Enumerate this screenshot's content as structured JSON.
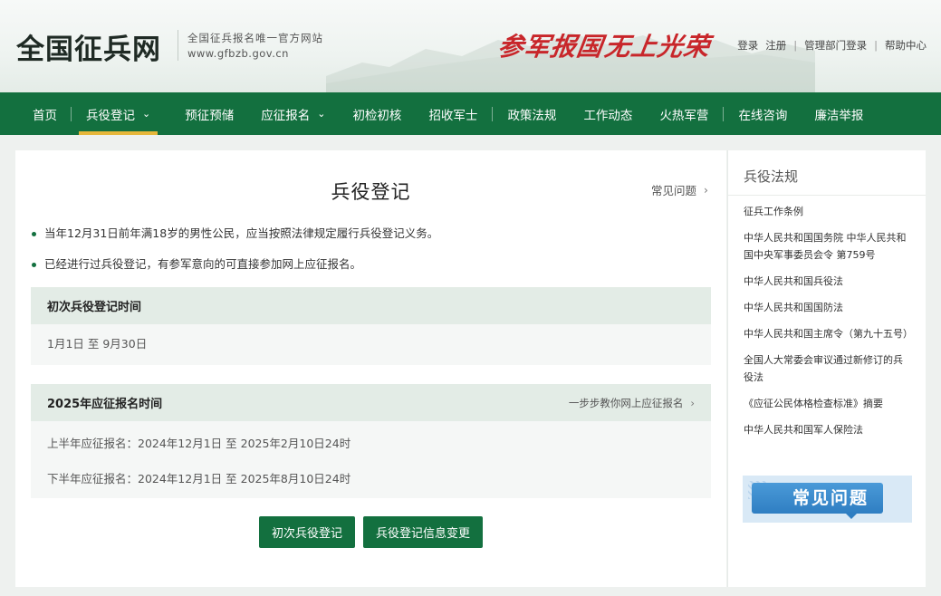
{
  "header": {
    "site_name": "全国征兵网",
    "tagline": "全国征兵报名唯一官方网站",
    "url": "www.gfbzb.gov.cn",
    "slogan_1": "参军报国",
    "slogan_2": "无上光荣",
    "links": {
      "login": "登录",
      "register": "注册",
      "admin_login": "管理部门登录",
      "help": "帮助中心"
    }
  },
  "nav": {
    "items": [
      {
        "label": "首页"
      },
      {
        "label": "兵役登记"
      },
      {
        "label": "预征预储"
      },
      {
        "label": "应征报名"
      },
      {
        "label": "初检初核"
      },
      {
        "label": "招收军士"
      },
      {
        "label": "政策法规"
      },
      {
        "label": "工作动态"
      },
      {
        "label": "火热军营"
      },
      {
        "label": "在线咨询"
      },
      {
        "label": "廉洁举报"
      }
    ],
    "active": "兵役登记"
  },
  "main": {
    "title": "兵役登记",
    "faq_link": "常见问题",
    "bullets": [
      "当年12月31日前年满18岁的男性公民，应当按照法律规定履行兵役登记义务。",
      "已经进行过兵役登记，有参军意向的可直接参加网上应征报名。"
    ],
    "first_registration": {
      "title": "初次兵役登记时间",
      "period": "1月1日 至 9月30日"
    },
    "enlistment": {
      "title": "2025年应征报名时间",
      "guide_link": "一步步教你网上应征报名",
      "first_half": "上半年应征报名：2024年12月1日 至 2025年2月10日24时",
      "second_half": "下半年应征报名：2024年12月1日 至 2025年8月10日24时"
    },
    "buttons": {
      "first_registration": "初次兵役登记",
      "info_change": "兵役登记信息变更"
    }
  },
  "sidebar": {
    "title": "兵役法规",
    "items": [
      "征兵工作条例",
      "中华人民共和国国务院 中华人民共和国中央军事委员会令 第759号",
      "中华人民共和国兵役法",
      "中华人民共和国国防法",
      "中华人民共和国主席令（第九十五号）",
      "全国人大常委会审议通过新修订的兵役法",
      "《应征公民体格检查标准》摘要",
      "中华人民共和国军人保险法"
    ],
    "banner_text": "常见问题"
  },
  "colors": {
    "brand_green": "#13703f",
    "accent_gold": "#e6b73a",
    "slogan_red": "#c8262a"
  }
}
